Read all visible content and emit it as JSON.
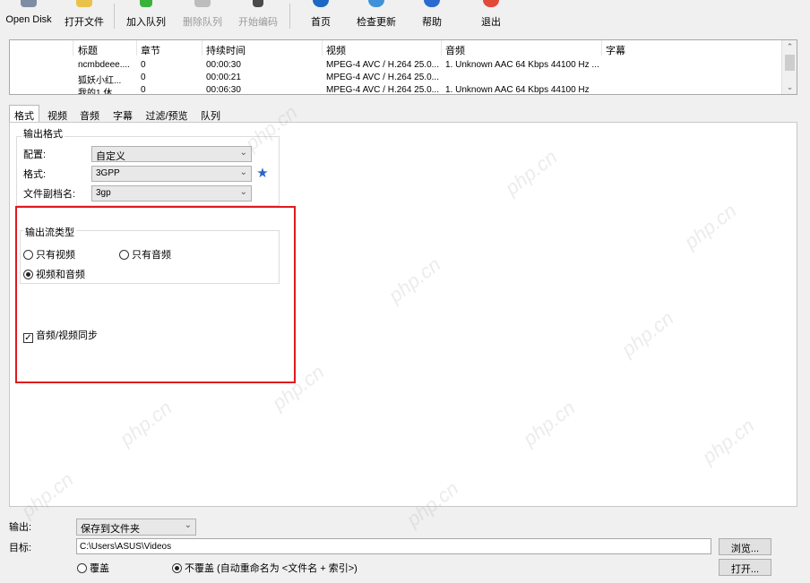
{
  "toolbar": {
    "items": [
      {
        "label": "Open Disk",
        "icon": "disk-icon",
        "enabled": true
      },
      {
        "label": "打开文件",
        "icon": "open-folder-icon",
        "enabled": true
      },
      {
        "label": "加入队列",
        "icon": "add-icon",
        "enabled": true
      },
      {
        "label": "删除队列",
        "icon": "remove-icon",
        "enabled": false
      },
      {
        "label": "开始编码",
        "icon": "encode-icon",
        "enabled": false
      },
      {
        "label": "首页",
        "icon": "home-icon",
        "enabled": true
      },
      {
        "label": "检查更新",
        "icon": "update-icon",
        "enabled": true
      },
      {
        "label": "帮助",
        "icon": "help-icon",
        "enabled": true
      },
      {
        "label": "退出",
        "icon": "power-icon",
        "enabled": true
      }
    ]
  },
  "queue": {
    "columns": [
      "标题",
      "章节",
      "持续时间",
      "视频",
      "音频",
      "字幕"
    ],
    "rows": [
      {
        "title": "ncmbdeee....",
        "chapters": "0",
        "duration": "00:00:30",
        "video": "MPEG-4 AVC / H.264 25.0...",
        "audio": "1. Unknown AAC  64 Kbps 44100 Hz ...",
        "subtitle": ""
      },
      {
        "title": "狐妖小红...",
        "chapters": "0",
        "duration": "00:00:21",
        "video": "MPEG-4 AVC / H.264 25.0...",
        "audio": "",
        "subtitle": ""
      },
      {
        "title": "我的1 休",
        "chapters": "0",
        "duration": "00:06:30",
        "video": "MPEG-4 AVC / H.264 25.0...",
        "audio": "1. Unknown AAC  64 Kbps 44100 Hz",
        "subtitle": ""
      }
    ]
  },
  "tabs": [
    "格式",
    "视频",
    "音频",
    "字幕",
    "过滤/预览",
    "队列"
  ],
  "format": {
    "group_title": "输出格式",
    "profile_label": "配置:",
    "profile_value": "自定义",
    "format_label": "格式:",
    "format_value": "3GPP",
    "ext_label": "文件副档名:",
    "ext_value": "3gp"
  },
  "stream": {
    "group_title": "输出流类型",
    "opt_video_only": "只有视频",
    "opt_audio_only": "只有音频",
    "opt_video_audio": "视频和音频",
    "selected": "video_audio",
    "sync_label": "音频/视频同步",
    "sync_checked": true
  },
  "output": {
    "label": "输出:",
    "value": "保存到文件夹",
    "target_label": "目标:",
    "target_value": "C:\\Users\\ASUS\\Videos",
    "browse": "浏览...",
    "open": "打开...",
    "overwrite": "覆盖",
    "no_overwrite": "不覆盖 (自动重命名为 <文件名 + 索引>)",
    "overwrite_selected": false
  },
  "colors": {
    "highlight": "#e0191d",
    "accent": "#2864c7"
  },
  "watermark": "php.cn"
}
